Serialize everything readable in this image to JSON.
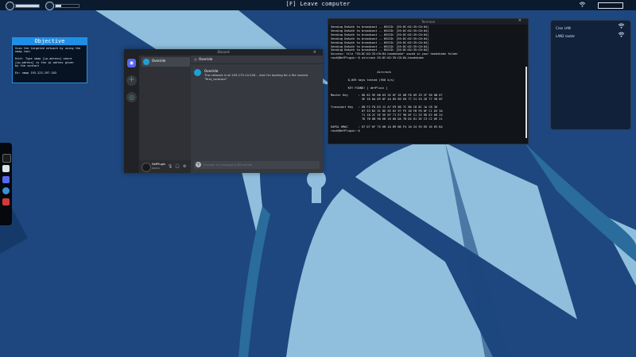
{
  "topbar": {
    "leave_label": "[F] Leave computer",
    "status_bar_1": {
      "fill": 1.0
    },
    "status_bar_2": {
      "fill": 0.25
    }
  },
  "objective": {
    "title": "Objective",
    "lines": [
      "Scan the targeted network by using the",
      "nmap tool",
      "",
      "Hint: Type nmap [ip-adress] where",
      "[ip-adress] is the ip adress given",
      "by the contact",
      "",
      "Ex: nmap 193.223.297.103"
    ]
  },
  "dock": {
    "items": [
      "terminal-icon",
      "notes-icon",
      "chat-icon",
      "browser-icon",
      "tools-icon"
    ]
  },
  "chat": {
    "window_title": "Discord",
    "close_glyph": "×",
    "server_logo": "◉",
    "add_server": "+",
    "explore": "◎",
    "dm_name": "Override",
    "channel_at": "@",
    "channel_name": "Override",
    "author": "Override",
    "message": "The network is at 193.175.14.240... And I'm looking for a file named \"first_contract\"",
    "user_name": "DefPlugin",
    "user_tag": "#0001",
    "mic": "🎙",
    "headset": "🎧",
    "settings": "⚙",
    "input_plus": "+",
    "input_placeholder": "Envoyer un message à @Override"
  },
  "terminal": {
    "window_title": "Terminal",
    "close_glyph": "×",
    "lines": [
      "Sending DeAuth to broadcast -- BSSID: [55:DC:02:35:C0:84]",
      "Sending DeAuth to broadcast -- BSSID: [55:DC:02:35:C0:84]",
      "Sending DeAuth to broadcast -- BSSID: [55:DC:02:35:C0:84]",
      "Sending DeAuth to broadcast -- BSSID: [55:DC:02:35:C0:84]",
      "Sending DeAuth to broadcast -- BSSID: [55:DC:02:35:C0:84]",
      "Sending DeAuth to broadcast -- BSSID: [55:DC:02:35:C0:84]",
      "Sending DeAuth to broadcast -- BSSID: [55:DC:02:35:C0:84]",
      "Success: file \"55:DC:02:35:C0:84.handshake\" saved in your handshake folder",
      "root@DefPlugin:~$ aircrack 55:DC:02:35:C0:84.handshake",
      "",
      "                           Aircrack",
      "",
      "          8,059 keys tested (956 k/s)",
      "",
      "          KEY FOUND! [ defPluin ]",
      "",
      "Master Key      : 6D 82 9E 0B 65 2E 6F 2E 6B F8 09 29 2F 58 0B 67",
      "                  5E 1D 0A 89 8F 4A 85 B9 ED 77 21 53 2D 77 58 8F",
      "",
      "Transient Key   : 6B F2 F8 D3 12 A7 E9 6B 7C B0 C8 8C 1A C8 36",
      "                  07 53 B2 31 8E 5E 62 97 F9 1B FB F6 8F C1 D3 3A",
      "                  71 18 2C 3E 5E 6F 71 E7 98 6F C1 23 9D E2 6D 24",
      "                  7D 7B 8B 98 6B 16 80 DA 7B D4 81 5E C3 C2 0E 21",
      "",
      "EAPOL HMAC      : 07 D7 0F 75 6B 1A B9 B6 F4 10 24 93 E6 16 65 B4",
      "root@DefPlugin:~$"
    ]
  },
  "wifi_panel": {
    "networks": [
      {
        "name": "Cron LAN",
        "icon": "wifi-icon"
      },
      {
        "name": "LAN2 router",
        "icon": "wifi-icon"
      }
    ]
  },
  "colors": {
    "wallpaper_dark": "#1d477e",
    "wallpaper_light": "#8fbfdc",
    "wallpaper_mid": "#2a6c9c",
    "accent": "#1e8fe6"
  }
}
